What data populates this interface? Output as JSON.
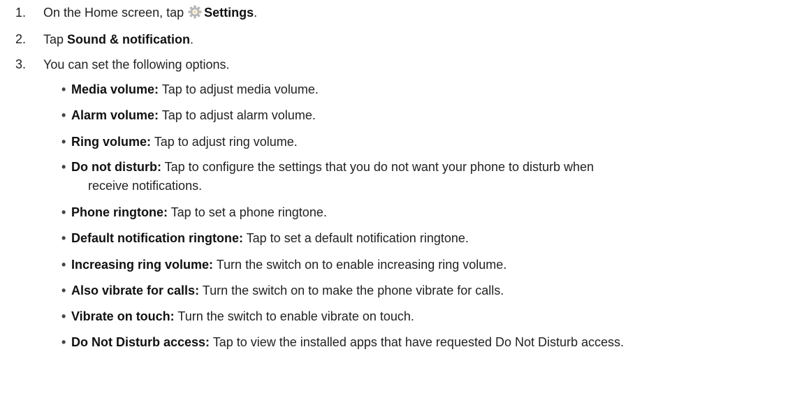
{
  "steps": [
    {
      "num": "1.",
      "pre": "On the Home screen, tap ",
      "icon": "settings-gear-icon",
      "bold": "Settings",
      "post": "."
    },
    {
      "num": "2.",
      "pre": "Tap ",
      "bold": "Sound & notification",
      "post": "."
    },
    {
      "num": "3.",
      "text": "You can set the following options."
    }
  ],
  "options": [
    {
      "term": "Media volume:",
      "desc": " Tap to adjust media volume."
    },
    {
      "term": "Alarm volume:",
      "desc": " Tap to adjust alarm volume."
    },
    {
      "term": "Ring volume:",
      "desc": " Tap to adjust ring volume."
    },
    {
      "term": "Do not disturb:",
      "desc": " Tap to configure the settings that you do not want your phone to disturb when",
      "cont": "receive notifications."
    },
    {
      "term": "Phone ringtone:",
      "desc": " Tap to set a phone ringtone."
    },
    {
      "term": "Default notification ringtone:",
      "desc": " Tap to set a default notification ringtone."
    },
    {
      "term": "Increasing ring volume:",
      "desc": " Turn the switch on to enable increasing ring volume."
    },
    {
      "term": "Also vibrate for calls:",
      "desc": " Turn the switch on to make the phone vibrate for calls."
    },
    {
      "term": "Vibrate on touch:",
      "desc": " Turn the switch to enable vibrate on touch."
    },
    {
      "term": "Do Not Disturb access:",
      "desc": " Tap to view the installed apps that have requested Do Not Disturb access."
    }
  ],
  "bullet_char": "•",
  "colors": {
    "gear": "#b8b8b8",
    "gear_accent": "#f0b030"
  }
}
